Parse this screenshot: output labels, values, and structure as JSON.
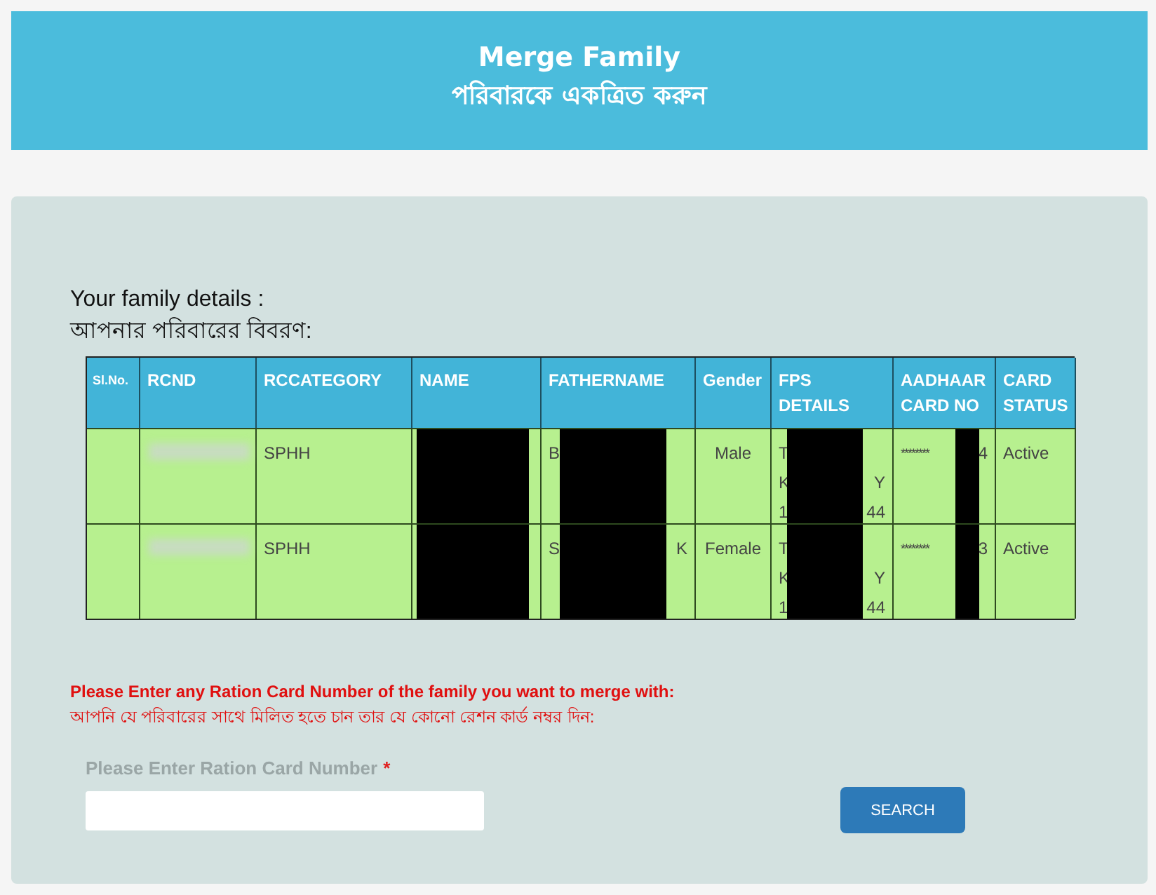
{
  "header": {
    "title": "Merge Family",
    "subtitle": "পরিবারকে একত্রিত করুন"
  },
  "details": {
    "heading": "Your family details :",
    "heading_bn": "আপনার পরিবারের বিবরণ:"
  },
  "table": {
    "columns": [
      {
        "label": "Sl.No."
      },
      {
        "label": "RCND"
      },
      {
        "label": "RCCATEGORY"
      },
      {
        "label": "NAME"
      },
      {
        "label": "FATHERNAME"
      },
      {
        "label": "Gender"
      },
      {
        "label": "FPS DETAILS"
      },
      {
        "label": "AADHAAR CARD NO"
      },
      {
        "label": "CARD STATUS"
      }
    ],
    "rows": [
      {
        "cells": [
          {},
          {
            "blurred": true
          },
          {
            "lines": [
              [
                "SPHH"
              ]
            ]
          },
          {
            "redacted": true
          },
          {
            "lines": [
              [
                "B"
              ]
            ],
            "redacted": true
          },
          {
            "lines": [
              [
                "Male"
              ]
            ]
          },
          {
            "lines": [
              [
                "T"
              ],
              [
                "K",
                "Y"
              ],
              [
                "1",
                "44"
              ]
            ],
            "redacted": true
          },
          {
            "lines": [
              [
                "********",
                "4"
              ]
            ],
            "redacted": true
          },
          {
            "lines": [
              [
                "Active"
              ]
            ]
          }
        ]
      },
      {
        "cells": [
          {},
          {
            "blurred": true
          },
          {
            "lines": [
              [
                "SPHH"
              ]
            ]
          },
          {
            "redacted": true
          },
          {
            "lines": [
              [
                "S",
                "K"
              ]
            ],
            "redacted": true
          },
          {
            "lines": [
              [
                "Female"
              ]
            ]
          },
          {
            "lines": [
              [
                "T"
              ],
              [
                "K",
                "Y"
              ],
              [
                "1",
                "44"
              ]
            ],
            "redacted": true
          },
          {
            "lines": [
              [
                "********",
                "3"
              ]
            ],
            "redacted": true
          },
          {
            "lines": [
              [
                "Active"
              ]
            ]
          }
        ]
      }
    ]
  },
  "notice": {
    "line_en": "Please Enter any Ration Card Number of the family you want to merge with:",
    "line_bn": "আপনি যে পরিবারের সাথে মিলিত হতে চান তার যে কোনো রেশন কার্ড নম্বর দিন:"
  },
  "form": {
    "label": "Please Enter Ration Card Number",
    "required_mark": "*",
    "required": true,
    "button": "SEARCH"
  }
}
